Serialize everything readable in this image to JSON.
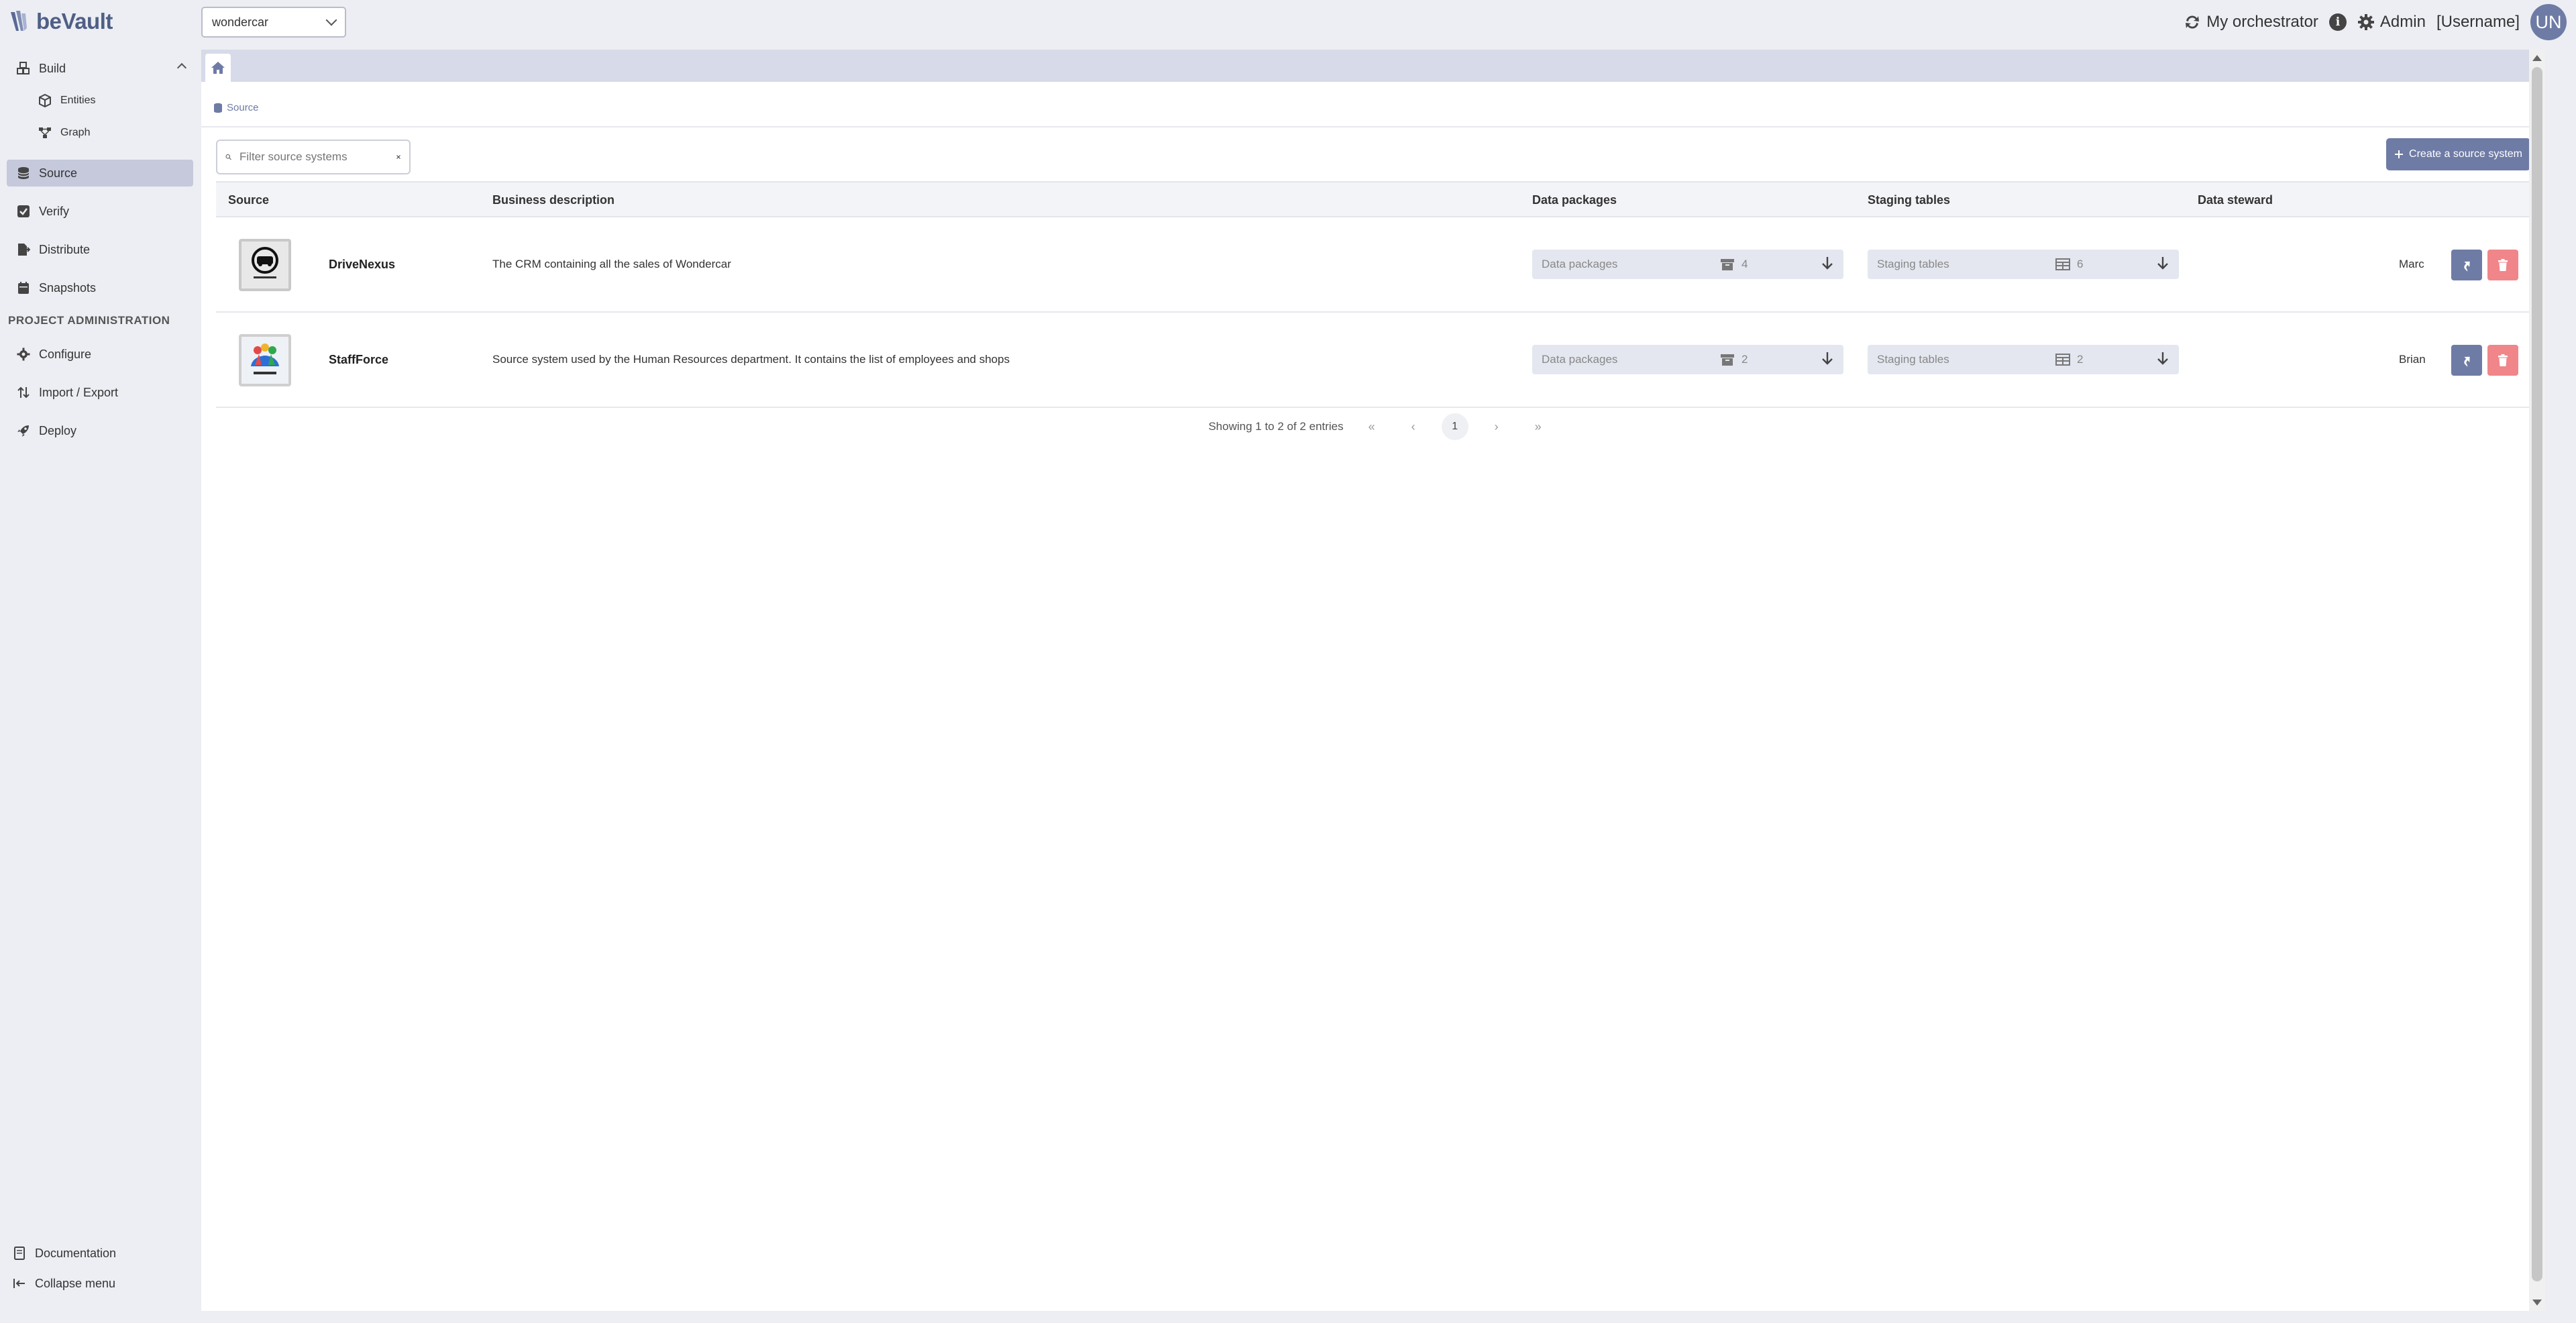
{
  "app": {
    "logo_text": "beVault"
  },
  "project_select": {
    "value": "wondercar"
  },
  "top_right": {
    "orchestrator": "My orchestrator",
    "admin": "Admin",
    "username": "[Username]",
    "avatar_initials": "UN"
  },
  "sidebar": {
    "build": "Build",
    "entities": "Entities",
    "graph": "Graph",
    "source": "Source",
    "verify": "Verify",
    "distribute": "Distribute",
    "snapshots": "Snapshots",
    "section_admin": "PROJECT ADMINISTRATION",
    "configure": "Configure",
    "import_export": "Import / Export",
    "deploy": "Deploy",
    "documentation": "Documentation",
    "collapse": "Collapse menu"
  },
  "breadcrumb": {
    "current": "Source"
  },
  "filter": {
    "placeholder": "Filter source systems"
  },
  "create_button": "Create a source system",
  "table": {
    "headers": {
      "source": "Source",
      "description": "Business description",
      "packages": "Data packages",
      "staging": "Staging tables",
      "steward": "Data steward"
    },
    "rows": [
      {
        "name": "DriveNexus",
        "description": "The CRM containing all the sales of Wondercar",
        "packages_label": "Data packages",
        "packages_count": "4",
        "staging_label": "Staging tables",
        "staging_count": "6",
        "steward": "Marc"
      },
      {
        "name": "StaffForce",
        "description": "Source system used by the Human Resources department. It contains the list of employees and shops",
        "packages_label": "Data packages",
        "packages_count": "2",
        "staging_label": "Staging tables",
        "staging_count": "2",
        "steward": "Brian"
      }
    ]
  },
  "pagination": {
    "summary": "Showing 1 to 2 of 2 entries",
    "first": "«",
    "prev": "‹",
    "page": "1",
    "next": "›",
    "last": "»"
  },
  "colors": {
    "accent": "#6e7ba5",
    "danger": "#f0868a",
    "sidebar_active": "#c5c9db",
    "background": "#eceef3"
  }
}
